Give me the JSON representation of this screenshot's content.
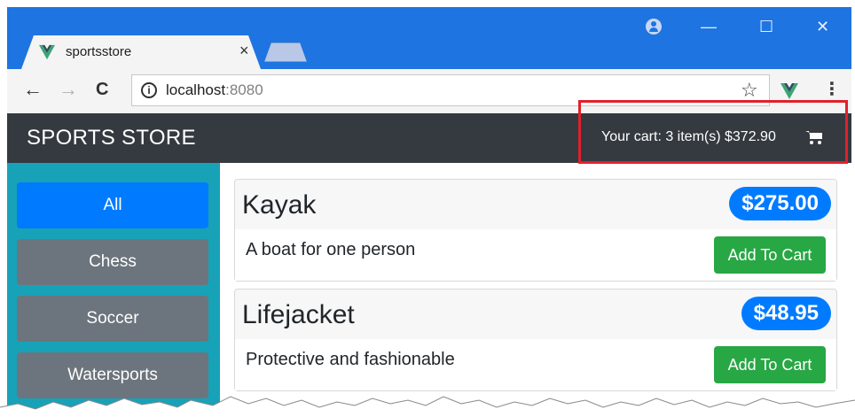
{
  "browser": {
    "tab_title": "sportsstore",
    "tab_close": "×",
    "url_host": "localhost",
    "url_port": ":8080",
    "back": "←",
    "forward": "→",
    "reload": "C",
    "star": "☆",
    "menu": "⋮",
    "minimize": "—",
    "maximize": "☐",
    "close": "✕"
  },
  "store": {
    "brand": "SPORTS STORE",
    "cart_summary": "Your cart: 3 item(s) $372.90"
  },
  "categories": [
    {
      "label": "All",
      "active": true
    },
    {
      "label": "Chess",
      "active": false
    },
    {
      "label": "Soccer",
      "active": false
    },
    {
      "label": "Watersports",
      "active": false
    }
  ],
  "products": [
    {
      "name": "Kayak",
      "price": "$275.00",
      "description": "A boat for one person",
      "button": "Add To Cart"
    },
    {
      "name": "Lifejacket",
      "price": "$48.95",
      "description": "Protective and fashionable",
      "button": "Add To Cart"
    }
  ],
  "colors": {
    "chrome_blue": "#1e74e0",
    "navbar": "#343a40",
    "sidebar": "#17a2b8",
    "primary": "#007bff",
    "secondary": "#6c757d",
    "success": "#28a745",
    "highlight": "#e0212b",
    "vue_green": "#3aa675"
  },
  "icons": [
    "vue-favicon-icon",
    "account-icon",
    "info-icon",
    "star-icon",
    "vue-extension-icon",
    "menu-icon",
    "cart-icon"
  ]
}
